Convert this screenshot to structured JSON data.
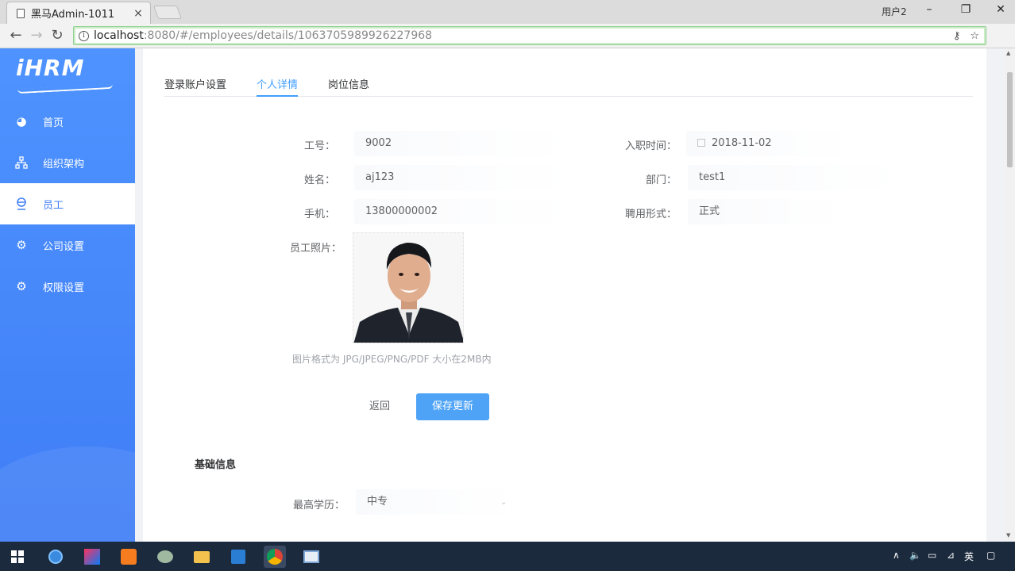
{
  "browser": {
    "tab_title": "黑马Admin-1011",
    "tab_close": "×",
    "user_label": "用户2",
    "url_host": "localhost",
    "url_rest": ":8080/#/employees/details/1063705989926227968",
    "icons": [
      "doc-icon",
      "back-icon",
      "forward-icon",
      "reload-icon",
      "info-icon",
      "key-icon",
      "star-icon",
      "minimize-icon",
      "maximize-icon",
      "close-icon"
    ]
  },
  "sidebar": {
    "logo": "iHRM",
    "items": [
      {
        "label": "首页",
        "icon": "dashboard-icon"
      },
      {
        "label": "组织架构",
        "icon": "org-chart-icon"
      },
      {
        "label": "员工",
        "icon": "employee-icon"
      },
      {
        "label": "公司设置",
        "icon": "gear-icon"
      },
      {
        "label": "权限设置",
        "icon": "gear-icon"
      }
    ],
    "active_index": 2,
    "colors": {
      "bg": "#3f7df6",
      "active_bg": "#ffffff"
    }
  },
  "tabs": [
    {
      "label": "登录账户设置"
    },
    {
      "label": "个人详情"
    },
    {
      "label": "岗位信息"
    }
  ],
  "active_tab": 1,
  "form": {
    "employee_no_label": "工号：",
    "employee_no": "9002",
    "hire_date_label": "入职时间：",
    "hire_date": "2018-11-02",
    "name_label": "姓名：",
    "name": "aj123",
    "department_label": "部门：",
    "department": "test1",
    "phone_label": "手机：",
    "phone": "13800000002",
    "employment_type_label": "聘用形式：",
    "employment_type": "正式",
    "photo_label": "员工照片：",
    "photo_hint": "图片格式为 JPG/JPEG/PNG/PDF 大小在2MB内",
    "back_button": "返回",
    "save_button": "保存更新",
    "accent": "#409eff"
  },
  "basic_info": {
    "title": "基础信息",
    "education_label": "最高学历：",
    "education": "中专"
  },
  "taskbar": {
    "ime": "英",
    "apps": [
      "start-icon",
      "ie-icon",
      "intellij-icon",
      "sublime-icon",
      "app-icon",
      "folder-icon",
      "vscode-icon",
      "chrome-icon",
      "window-icon"
    ]
  }
}
